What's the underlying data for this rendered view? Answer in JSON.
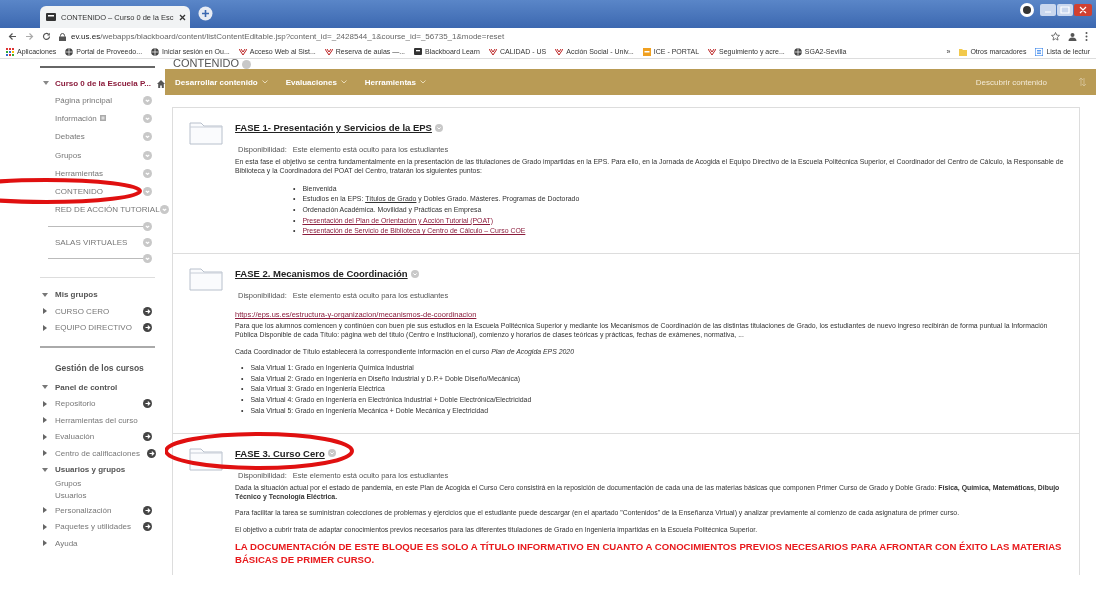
{
  "browser": {
    "tab_title": "CONTENIDO – Curso 0 de la Esc",
    "url_host": "ev.us.es",
    "url_path": "/webapps/blackboard/content/listContentEditable.jsp?content_id=_2428544_1&course_id=_56735_1&mode=reset",
    "bookmarks": [
      {
        "label": "Aplicaciones",
        "kind": "apps"
      },
      {
        "label": "Portal de Proveedo...",
        "kind": "globe"
      },
      {
        "label": "Iniciar sesión en Ou...",
        "kind": "globe"
      },
      {
        "label": "Acceso Web al Sist...",
        "kind": "us"
      },
      {
        "label": "Reserva de aulas —...",
        "kind": "us"
      },
      {
        "label": "Blackboard Learn",
        "kind": "bb"
      },
      {
        "label": "CALIDAD - US",
        "kind": "us"
      },
      {
        "label": "Acción Social - Univ...",
        "kind": "us"
      },
      {
        "label": "ICE - PORTAL",
        "kind": "ice"
      },
      {
        "label": "Seguimiento y acre...",
        "kind": "us"
      },
      {
        "label": "SGA2-Sevilla",
        "kind": "globe"
      }
    ],
    "overflow": "»",
    "other_bookmarks": [
      {
        "label": "Otros marcadores",
        "kind": "folder"
      },
      {
        "label": "Lista de lectur",
        "kind": "list"
      }
    ]
  },
  "page_title": "CONTENIDO",
  "course_menu": {
    "title": "Curso 0 de la Escuela P...",
    "expanded": true,
    "items": [
      {
        "kind": "link",
        "label": "Página principal",
        "circled": false,
        "has_icon": false
      },
      {
        "kind": "link",
        "label": "Información",
        "circled": false,
        "has_icon": true
      },
      {
        "kind": "link",
        "label": "Debates",
        "circled": false,
        "has_icon": false
      },
      {
        "kind": "link",
        "label": "Grupos",
        "circled": false,
        "has_icon": false
      },
      {
        "kind": "link",
        "label": "Herramientas",
        "circled": false,
        "has_icon": false
      },
      {
        "kind": "link",
        "label": "CONTENIDO",
        "circled": true,
        "has_icon": false
      },
      {
        "kind": "link",
        "label": "RED DE ACCIÓN TUTORIAL",
        "circled": false,
        "has_icon": false
      },
      {
        "kind": "divider"
      },
      {
        "kind": "link",
        "label": "SALAS VIRTUALES",
        "circled": false,
        "has_icon": false
      },
      {
        "kind": "divider"
      }
    ]
  },
  "my_groups": {
    "kind": "node",
    "label": "Mis grupos",
    "expanded": true,
    "menu": false,
    "children": [
      {
        "kind": "node",
        "label": "CURSO CERO",
        "expanded": false,
        "menu": true
      },
      {
        "kind": "node",
        "label": "EQUIPO DIRECTIVO",
        "expanded": false,
        "menu": true
      }
    ]
  },
  "course_management": {
    "title": "Gestión de los cursos",
    "tree": [
      {
        "kind": "node",
        "label": "Panel de control",
        "expanded": true,
        "menu": false,
        "children": [
          {
            "kind": "node",
            "label": "Repositorio",
            "expanded": false,
            "menu": true
          },
          {
            "kind": "node",
            "label": "Herramientas del curso",
            "expanded": false,
            "menu": false
          },
          {
            "kind": "node",
            "label": "Evaluación",
            "expanded": false,
            "menu": true
          },
          {
            "kind": "node",
            "label": "Centro de calificaciones",
            "expanded": false,
            "menu": true
          },
          {
            "kind": "node",
            "label": "Usuarios y grupos",
            "expanded": true,
            "menu": false,
            "children": [
              {
                "kind": "leaf",
                "label": "Grupos",
                "menu": false
              },
              {
                "kind": "leaf",
                "label": "Usuarios",
                "menu": false
              }
            ]
          },
          {
            "kind": "node",
            "label": "Personalización",
            "expanded": false,
            "menu": true
          },
          {
            "kind": "node",
            "label": "Paquetes y utilidades",
            "expanded": false,
            "menu": true
          },
          {
            "kind": "node",
            "label": "Ayuda",
            "expanded": false,
            "menu": false
          }
        ]
      }
    ]
  },
  "toolbar": {
    "menus": [
      "Desarrollar contenido",
      "Evaluaciones",
      "Herramientas"
    ],
    "right": "Descubrir contenido"
  },
  "items": [
    {
      "title": "FASE 1- Presentación y Servicios de la EPS",
      "circled": false,
      "availability_label": "Disponibilidad:",
      "availability": "Este elemento está oculto para los estudiantes",
      "blocks": [
        {
          "kind": "paragraph",
          "text": "En esta fase el objetivo se centra fundamentalmente en la presentación de las titulaciones de Grado impartidas en la EPS. Para ello, en la Jornada de Acogida el Equipo Directivo de la Escuela Politécnica Superior, el Coordinador del Centro de Cálculo, la Responsable de Biblioteca y la Coordinadora del POAT del Centro, tratarán los siguientes puntos:"
        },
        {
          "kind": "indented_list",
          "bullet": "•",
          "items": [
            [
              {
                "text": "Bienvenida",
                "link": false
              }
            ],
            [
              {
                "text": "Estudios en la EPS: ",
                "link": false
              },
              {
                "text": "Títulos de Grado",
                "link": true
              },
              {
                "text": " y Dobles Grado. Másteres. Programas de Doctorado",
                "link": false
              }
            ],
            [
              {
                "text": "Ordenación Académica. Movilidad y Prácticas en Empresa",
                "link": false
              }
            ],
            [
              {
                "text": "Presentación del Plan de Orientación y Acción Tutorial  (POAT)",
                "link": true
              }
            ],
            [
              {
                "text": "Presentación de Servicio de Biblioteca y Centro de Cálculo  – Curso COE",
                "link": true
              }
            ]
          ]
        }
      ]
    },
    {
      "title": "FASE 2. Mecanismos de Coordinación",
      "circled": false,
      "availability_label": "Disponibilidad:",
      "availability": "Este elemento está oculto para los estudiantes",
      "blocks": [
        {
          "kind": "link",
          "text": "https://eps.us.es/estructura-y-organizacion/mecanismos-de-coordinacion"
        },
        {
          "kind": "paragraph",
          "text": "Para que los alumnos comiencen y continúen con buen pie sus estudios en la Escuela Politécnica Superior y mediante los Mecanismos de Coordinación de las distintas titulaciones de Grado, los estudiantes de nuevo ingreso recibirán de forma puntual la Información Pública Disponible de cada Título: página web del título (Centro e Institucional), comienzo y horarios de clases teóricas y prácticas, fechas de exámenes, normativa, ..."
        },
        {
          "kind": "paragraph",
          "text": "Cada Coordinador de Título establecerá la correspondiente información en el curso *Plan de Acogida EPS 2020*"
        },
        {
          "kind": "list",
          "bullet": "•",
          "items": [
            [
              {
                "text": "Sala Virtual 1: Grado en Ingeniería Química Industrial",
                "link": false
              }
            ],
            [
              {
                "text": "Sala Virtual 2: Grado en Ingeniería en Diseño Industrial y D.P.+ Doble Diseño/Mecánica)",
                "link": false
              }
            ],
            [
              {
                "text": "Sala Virtual 3: Grado en Ingeniería Eléctrica",
                "link": false
              }
            ],
            [
              {
                "text": "Sala Virtual 4: Grado en Ingeniería en Electrónica Industrial + Doble Electrónica/Electricidad",
                "link": false
              }
            ],
            [
              {
                "text": "Sala Virtual 5: Grado en Ingeniería Mecánica + Doble Mecánica y Electricidad",
                "link": false
              }
            ]
          ]
        }
      ]
    },
    {
      "title": "FASE 3. Curso Cero",
      "circled": true,
      "availability_label": "Disponibilidad:",
      "availability": "Este elemento está oculto para los estudiantes",
      "blocks": [
        {
          "kind": "paragraph",
          "text": "Dada la situación actual por el estado de pandemia, en este Plan de Acogida el Curso Cero consistirá en la reposición de documentación de cada una de las materias básicas que componen Primer Curso de Grado y Doble Grado: **Física, Química, Matemáticas, Dibujo Técnico y Tecnología Eléctrica.**"
        },
        {
          "kind": "paragraph",
          "text": "Para facilitar la tarea se suministran colecciones de problemas y ejercicios que el estudiante puede descargar (en el apartado \"Contenidos\" de la Enseñanza Virtual) y analizar previamente al comienzo de cada asignatura de primer curso."
        },
        {
          "kind": "paragraph",
          "text": "El objetivo a cubrir trata de adaptar conocimientos previos necesarios para las diferentes titulaciones de Grado en Ingeniería impartidas en la Escuela Politécnica Superior."
        },
        {
          "kind": "alert",
          "text": "LA DOCUMENTACIÓN DE ESTE BLOQUE ES SOLO A TÍTULO INFORMATIVO EN CUANTO A CONOCIMIENTOS PREVIOS NECESARIOS PARA AFRONTAR CON ÉXITO LAS MATERIAS BÁSICAS DE PRIMER CURSO."
        }
      ]
    }
  ]
}
